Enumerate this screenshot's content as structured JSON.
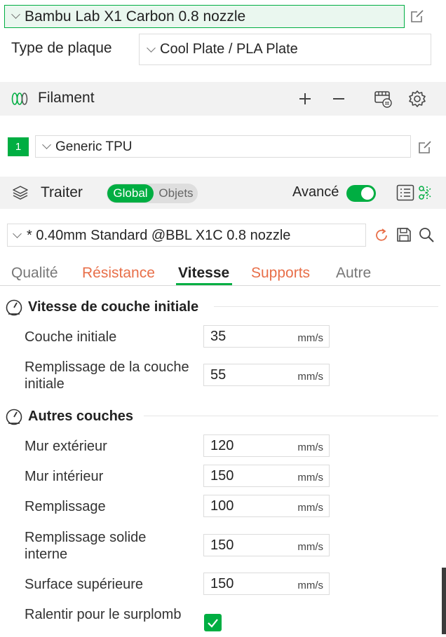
{
  "printer": {
    "name": "Bambu Lab X1 Carbon 0.8 nozzle"
  },
  "plate": {
    "label": "Type de plaque",
    "value": "Cool Plate / PLA Plate"
  },
  "filament": {
    "title": "Filament",
    "items": [
      {
        "index": "1",
        "name": "Generic TPU"
      }
    ]
  },
  "process": {
    "title": "Traiter",
    "mode_global": "Global",
    "mode_objects": "Objets",
    "advanced_label": "Avancé",
    "preset": "* 0.40mm Standard @BBL X1C 0.8 nozzle"
  },
  "tabs": [
    {
      "label": "Qualité"
    },
    {
      "label": "Résistance"
    },
    {
      "label": "Vitesse"
    },
    {
      "label": "Supports"
    },
    {
      "label": "Autre"
    }
  ],
  "groups": [
    {
      "title": "Vitesse de couche initiale",
      "params": [
        {
          "label": "Couche initiale",
          "value": "35",
          "unit": "mm/s"
        },
        {
          "label": "Remplissage de la couche initiale",
          "value": "55",
          "unit": "mm/s"
        }
      ]
    },
    {
      "title": "Autres couches",
      "params": [
        {
          "label": "Mur extérieur",
          "value": "120",
          "unit": "mm/s"
        },
        {
          "label": "Mur intérieur",
          "value": "150",
          "unit": "mm/s"
        },
        {
          "label": "Remplissage",
          "value": "100",
          "unit": "mm/s"
        },
        {
          "label": "Remplissage solide interne",
          "value": "150",
          "unit": "mm/s"
        },
        {
          "label": "Surface supérieure",
          "value": "150",
          "unit": "mm/s"
        },
        {
          "label": "Ralentir pour le surplomb",
          "checked": true
        }
      ]
    }
  ],
  "colors": {
    "accent": "#00ae42",
    "warning_tab": "#e86f49"
  }
}
